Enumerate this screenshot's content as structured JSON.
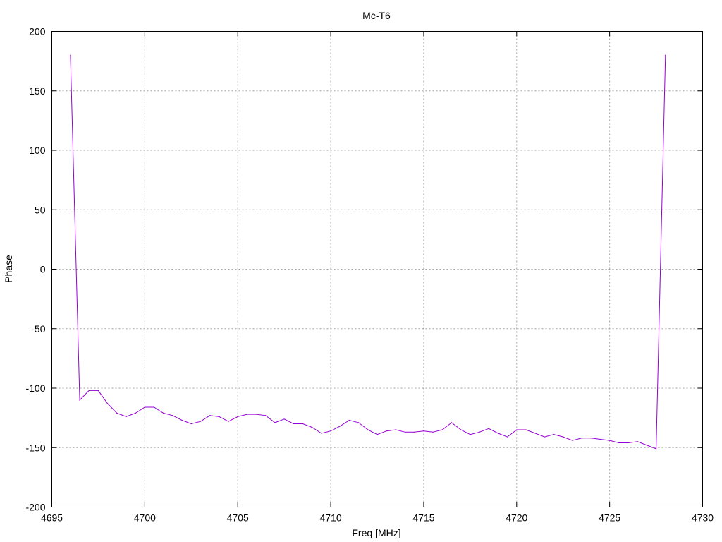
{
  "chart_data": {
    "type": "line",
    "title": "Mc-T6",
    "xlabel": "Freq [MHz]",
    "ylabel": "Phase",
    "xlim": [
      4695,
      4730
    ],
    "ylim": [
      -200,
      200
    ],
    "grid": true,
    "x_ticks": [
      "4695",
      "4700",
      "4705",
      "4710",
      "4715",
      "4720",
      "4725",
      "4730"
    ],
    "y_ticks": [
      "200",
      "150",
      "100",
      "50",
      "0",
      "-50",
      "-100",
      "-150",
      "-200"
    ],
    "x_tick_values": [
      4695,
      4700,
      4705,
      4710,
      4715,
      4720,
      4725,
      4730
    ],
    "y_tick_values": [
      200,
      150,
      100,
      50,
      0,
      -50,
      -100,
      -150,
      -200
    ],
    "series": [
      {
        "color": "#9400d3",
        "x": [
          4696.0,
          4696.5,
          4697.0,
          4697.5,
          4698.0,
          4698.5,
          4699.0,
          4699.5,
          4700.0,
          4700.5,
          4701.0,
          4701.5,
          4702.0,
          4702.5,
          4703.0,
          4703.5,
          4704.0,
          4704.5,
          4705.0,
          4705.5,
          4706.0,
          4706.5,
          4707.0,
          4707.5,
          4708.0,
          4708.5,
          4709.0,
          4709.5,
          4710.0,
          4710.5,
          4711.0,
          4711.5,
          4712.0,
          4712.5,
          4713.0,
          4713.5,
          4714.0,
          4714.5,
          4715.0,
          4715.5,
          4716.0,
          4716.5,
          4717.0,
          4717.5,
          4718.0,
          4718.5,
          4719.0,
          4719.5,
          4720.0,
          4720.5,
          4721.0,
          4721.5,
          4722.0,
          4722.5,
          4723.0,
          4723.5,
          4724.0,
          4724.5,
          4725.0,
          4725.5,
          4726.0,
          4726.5,
          4727.0,
          4727.5,
          4728.0
        ],
        "y": [
          180,
          -110,
          -102,
          -102,
          -113,
          -121,
          -124,
          -121,
          -116,
          -116,
          -121,
          -123,
          -127,
          -130,
          -128,
          -123,
          -124,
          -128,
          -124,
          -122,
          -122,
          -123,
          -129,
          -126,
          -130,
          -130,
          -133,
          -138,
          -136,
          -132,
          -127,
          -129,
          -135,
          -139,
          -136,
          -135,
          -137,
          -137,
          -136,
          -137,
          -135,
          -129,
          -135,
          -139,
          -137,
          -134,
          -138,
          -141,
          -135,
          -135,
          -138,
          -141,
          -139,
          -141,
          -144,
          -142,
          -142,
          -143,
          -144,
          -146,
          -146,
          -145,
          -148,
          -151,
          180
        ]
      }
    ]
  }
}
